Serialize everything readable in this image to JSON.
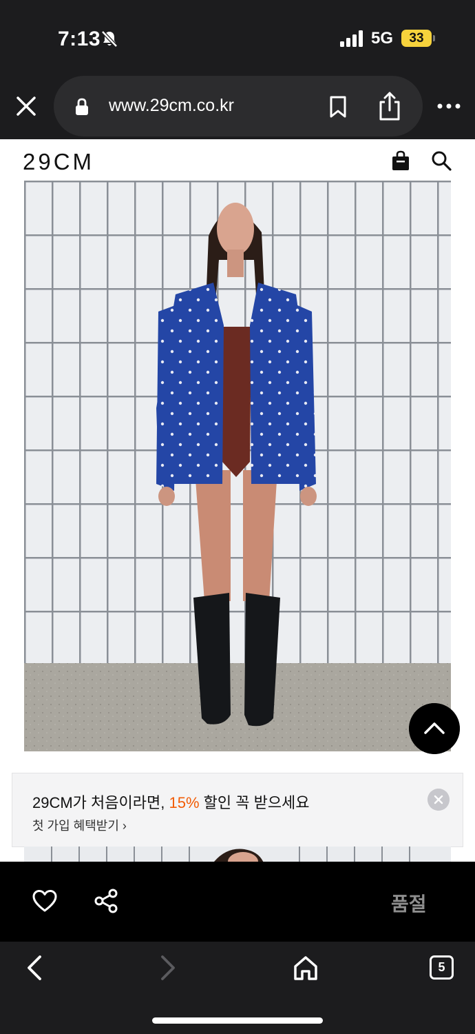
{
  "status_bar": {
    "time": "7:13",
    "network": "5G",
    "battery": "33"
  },
  "browser": {
    "url": "www.29cm.co.kr",
    "open_tabs": "5"
  },
  "site": {
    "logo": "29CM"
  },
  "banner": {
    "headline_prefix": "29CM가 처음이라면, ",
    "headline_accent": "15%",
    "headline_suffix": " 할인 꼭 받으세요",
    "link": "첫 가입 혜택받기 ›",
    "accent_color": "#f25c05"
  },
  "product_bar": {
    "status": "품절"
  }
}
